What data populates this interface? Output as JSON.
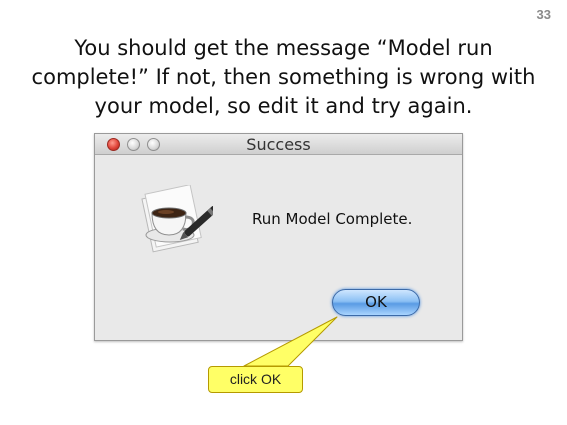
{
  "slide": {
    "page_number": "33",
    "instruction": "You should get the message “Model run complete!” If not, then something is wrong with your model, so edit it and try again."
  },
  "dialog": {
    "title": "Success",
    "message": "Run Model Complete.",
    "ok_label": "OK",
    "app_icon": "coffee-cup-icon",
    "window_controls": [
      "close",
      "minimize",
      "zoom"
    ]
  },
  "callout": {
    "text": "click OK",
    "color": "#ffff66"
  },
  "colors": {
    "close_button": "#e0453a",
    "ok_button": "#8cc0f4"
  }
}
